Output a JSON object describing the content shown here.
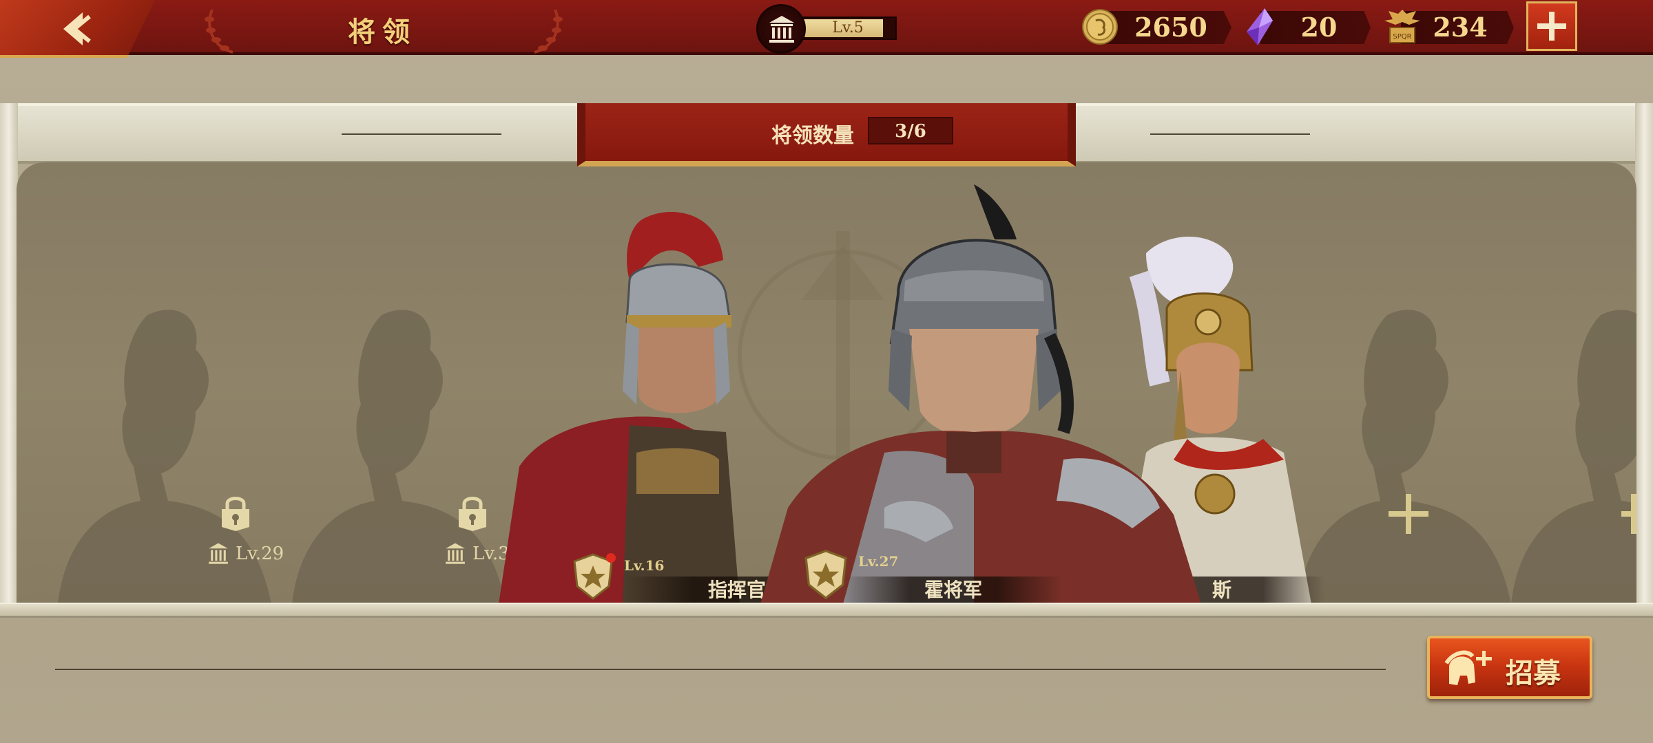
{
  "header": {
    "title": "将领",
    "hall_level": "Lv.5",
    "hall_progress": 0.88,
    "resources": [
      {
        "name": "coin",
        "icon": "gold-coin-icon",
        "value": "2650"
      },
      {
        "name": "gem",
        "icon": "purple-gem-icon",
        "value": "20"
      },
      {
        "name": "legion",
        "icon": "spqr-eagle-icon",
        "value": "234"
      }
    ]
  },
  "banner": {
    "label": "将领数量",
    "count": "3/6"
  },
  "locked_slots": [
    {
      "level": "Lv.29"
    },
    {
      "level": "Lv.3"
    }
  ],
  "commanders": [
    {
      "name": "指挥官",
      "level": "Lv.16",
      "has_alert": true
    },
    {
      "name": "霍将军",
      "level": "Lv.27",
      "has_alert": false
    },
    {
      "name": "斯",
      "level": "",
      "has_alert": false
    }
  ],
  "recruit": {
    "label": "招募"
  },
  "colors": {
    "primary_red": "#8a1a14",
    "gold": "#f3cf7a",
    "parchment": "#b9ae97"
  }
}
